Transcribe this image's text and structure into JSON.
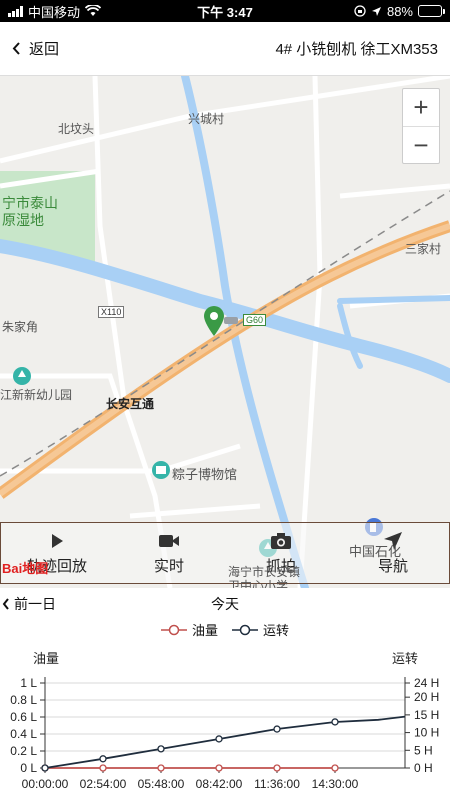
{
  "status_bar": {
    "carrier": "中国移动",
    "time": "下午 3:47",
    "battery_percent": "88%",
    "battery_level": 0.88,
    "icons": [
      "signal-icon",
      "wifi-icon",
      "orientation-lock-icon",
      "location-icon",
      "battery-icon"
    ]
  },
  "header": {
    "back_label": "返回",
    "title": "4# 小铣刨机 徐工XM353"
  },
  "map": {
    "zoom_in": "+",
    "zoom_out": "−",
    "labels": {
      "xingcheng": "兴城村",
      "beifentou": "北坟头",
      "taishan": "宁市泰山",
      "wetland": "原湿地",
      "sanjia": "三家村",
      "zhujiajiao": "朱家角",
      "kindergarten": "江新新幼儿园",
      "changan": "长安互通",
      "zongzi": "粽子博物馆",
      "sinopec": "中国石化",
      "school1": "海宁市长安镇",
      "school2": "卫中心小学"
    },
    "shields": {
      "x110": "X110",
      "g60": "G60"
    },
    "baidu_logo": "Bai地图",
    "playback": [
      {
        "label": "轨迹回放",
        "icon": "play-icon"
      },
      {
        "label": "实时",
        "icon": "video-camera-icon"
      },
      {
        "label": "抓拍",
        "icon": "camera-icon"
      },
      {
        "label": "导航",
        "icon": "navigation-arrow-icon"
      }
    ],
    "brand_color": "#1a4fd8"
  },
  "date_nav": {
    "prev_label": "前一日",
    "current_label": "今天"
  },
  "legend": {
    "series1": "油量",
    "series2": "运转"
  },
  "chart_data": {
    "type": "line",
    "left_axis_title": "油量",
    "right_axis_title": "运转",
    "x_ticks": [
      "00:00:00",
      "02:54:00",
      "05:48:00",
      "08:42:00",
      "11:36:00",
      "14:30:00"
    ],
    "y_left_ticks": [
      "0 L",
      "0.2 L",
      "0.4 L",
      "0.6 L",
      "0.8 L",
      "1 L"
    ],
    "y_right_ticks": [
      "0 H",
      "5 H",
      "10 H",
      "15 H",
      "20 H",
      "24 H"
    ],
    "y_left_range": [
      0,
      1
    ],
    "y_right_range": [
      0,
      24
    ],
    "x_range_minutes": [
      0,
      1080
    ],
    "series": [
      {
        "name": "油量",
        "axis": "left",
        "color": "#c0504d",
        "x_minutes": [
          0,
          174,
          348,
          522,
          696,
          870
        ],
        "values": [
          0,
          0,
          0,
          0,
          0,
          0
        ]
      },
      {
        "name": "运转",
        "axis": "right",
        "color": "#1f2d3d",
        "x_minutes": [
          0,
          174,
          348,
          522,
          696,
          870,
          1000,
          1080
        ],
        "values": [
          0,
          2.6,
          5.4,
          8.2,
          11.0,
          13.0,
          13.6,
          14.5
        ]
      }
    ],
    "grid": true,
    "legend_position": "top"
  }
}
